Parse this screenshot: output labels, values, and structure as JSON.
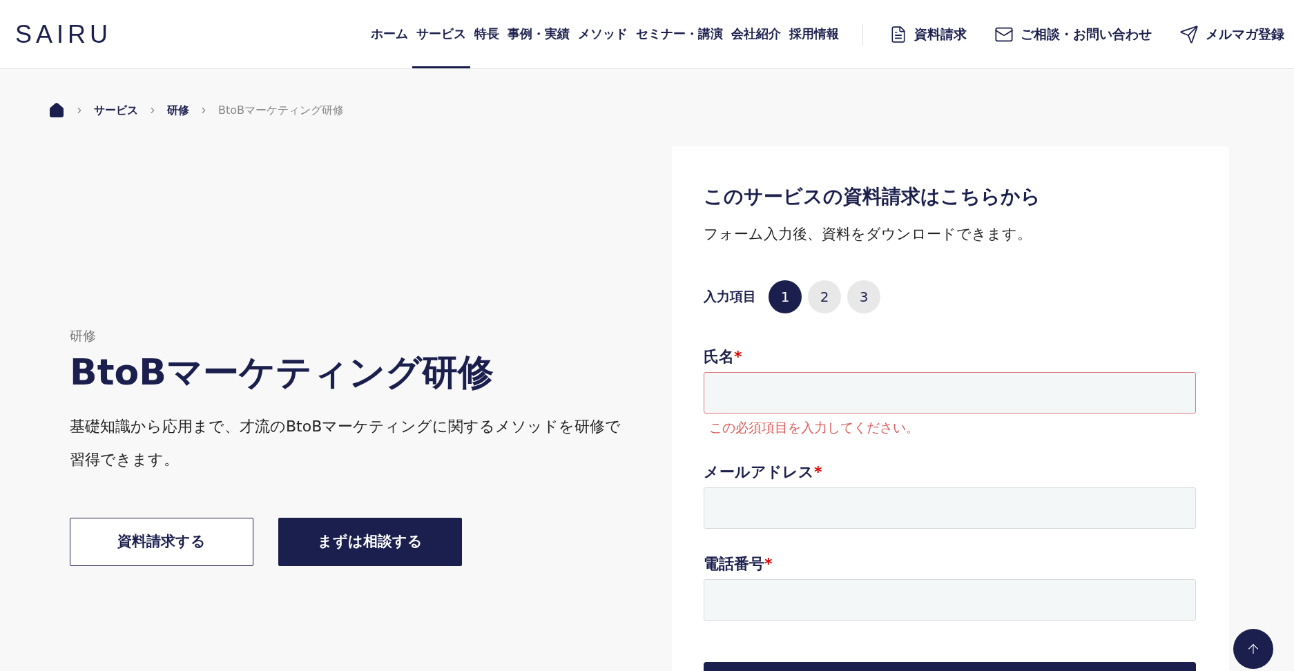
{
  "header": {
    "logo": "SAIRU",
    "nav": [
      {
        "label": "ホーム",
        "selected": false
      },
      {
        "label": "サービス",
        "selected": true
      },
      {
        "label": "特長",
        "selected": false
      },
      {
        "label": "事例・実績",
        "selected": false
      },
      {
        "label": "メソッド",
        "selected": false
      },
      {
        "label": "セミナー・講演",
        "selected": false
      },
      {
        "label": "会社紹介",
        "selected": false
      },
      {
        "label": "採用情報",
        "selected": false
      }
    ],
    "actions": [
      {
        "kind": "document",
        "label": "資料請求"
      },
      {
        "kind": "mail",
        "label": "ご相談・お問い合わせ"
      },
      {
        "kind": "send",
        "label": "メルマガ登録"
      }
    ]
  },
  "breadcrumb": [
    {
      "label": "サービス",
      "current": false
    },
    {
      "label": "研修",
      "current": false
    },
    {
      "label": "BtoBマーケティング研修",
      "current": true
    }
  ],
  "hero": {
    "category": "研修",
    "title": "BtoBマーケティング研修",
    "description": "基礎知識から応用まで、才流のBtoBマーケティングに関するメソッドを研修で習得できます。",
    "buttons": [
      {
        "kind": "outline",
        "label": "資料請求する"
      },
      {
        "kind": "solid",
        "label": "まずは相談する"
      }
    ]
  },
  "form": {
    "title": "このサービスの資料請求はこちらから",
    "subtitle": "フォーム入力後、資料をダウンロードできます。",
    "steps_label": "入力項目",
    "steps": [
      {
        "label": "1",
        "selected": true
      },
      {
        "label": "2",
        "selected": false
      },
      {
        "label": "3",
        "selected": false
      }
    ],
    "fields": [
      {
        "label": "氏名",
        "required_mark": "*",
        "invalid": true,
        "error": "この必須項目を入力してください。"
      },
      {
        "label": "メールアドレス",
        "required_mark": "*",
        "invalid": false
      },
      {
        "label": "電話番号",
        "required_mark": "*",
        "invalid": false
      }
    ]
  }
}
